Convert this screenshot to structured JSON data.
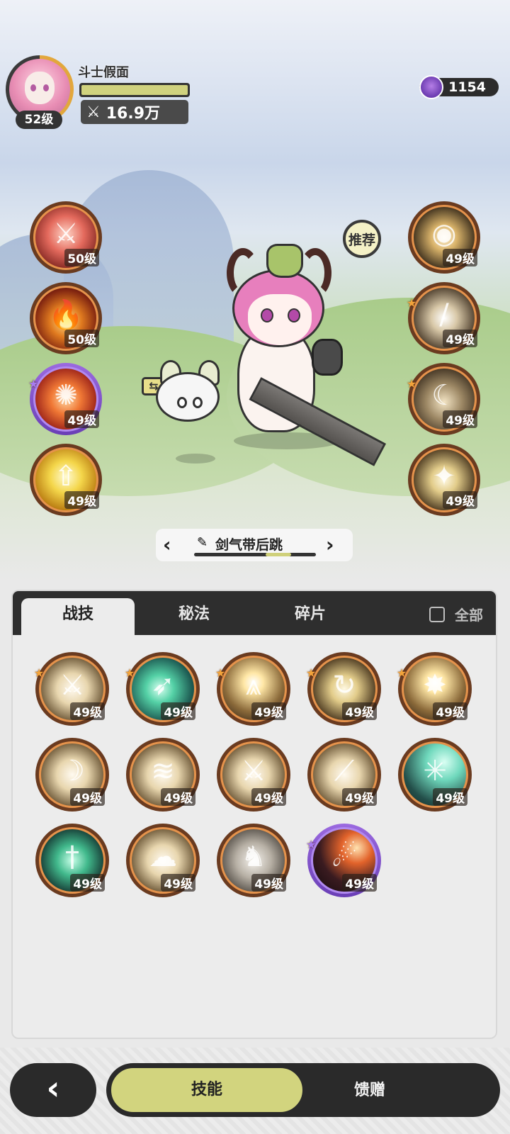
{
  "player": {
    "name": "斗士假面",
    "level": "52级",
    "power": "16.9万",
    "hp_fill": 1.0
  },
  "currency": {
    "amount": "1154",
    "icon": "purple-gem-icon"
  },
  "recommend_label": "推荐",
  "left_skills": [
    {
      "level": "50级",
      "icon": "red-figure-sword-icon"
    },
    {
      "level": "50级",
      "icon": "fire-icon"
    },
    {
      "level": "49级",
      "icon": "flame-sun-icon",
      "star": "purple"
    },
    {
      "level": "49级",
      "icon": "gold-arrow-up-icon"
    }
  ],
  "right_skills": [
    {
      "level": "49级",
      "icon": "eye-icon"
    },
    {
      "level": "49级",
      "icon": "blade-icon",
      "star": "orange"
    },
    {
      "level": "49级",
      "icon": "beast-claw-icon",
      "star": "orange"
    },
    {
      "level": "49级",
      "icon": "spiral-target-icon"
    }
  ],
  "preset": {
    "label": "剑气带后跳",
    "position": 0.5
  },
  "tabs": [
    "战技",
    "秘法",
    "碎片"
  ],
  "active_tab": "战技",
  "filter_all_label": "全部",
  "grid_skills": [
    {
      "level": "49级",
      "icon": "sword-slash-icon",
      "star": "orange"
    },
    {
      "level": "49级",
      "icon": "teal-dash-icon",
      "star": "orange"
    },
    {
      "level": "49级",
      "icon": "ground-spikes-icon",
      "star": "orange"
    },
    {
      "level": "49级",
      "icon": "whirl-icon",
      "star": "orange"
    },
    {
      "level": "49级",
      "icon": "explosion-icon",
      "star": "orange"
    },
    {
      "level": "49级",
      "icon": "crescent-icon"
    },
    {
      "level": "49级",
      "icon": "wind-slash-icon"
    },
    {
      "level": "49级",
      "icon": "figure-attack-icon"
    },
    {
      "level": "49级",
      "icon": "diagonal-slash-icon"
    },
    {
      "level": "49级",
      "icon": "web-icon"
    },
    {
      "level": "49级",
      "icon": "teal-sword-icon"
    },
    {
      "level": "49级",
      "icon": "tornado-icon"
    },
    {
      "level": "49级",
      "icon": "elephant-icon"
    },
    {
      "level": "49级",
      "icon": "comet-icon",
      "star": "purple"
    }
  ],
  "bottom_nav": {
    "back_icon": "chevron-left-icon",
    "skills_label": "技能",
    "gift_label": "馈赠"
  }
}
